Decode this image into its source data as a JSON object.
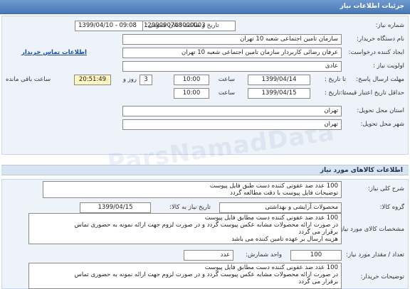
{
  "header": {
    "title": "جزئیات اطلاعات نیاز"
  },
  "need_number": {
    "label": "شماره نیاز:",
    "value": "1299090748000003"
  },
  "announce_date": {
    "label": "تاریخ و ساعت اعلان عمومی:",
    "value": "1399/04/10 - 09:08"
  },
  "buyer_org": {
    "label": "نام دستگاه خریدار:",
    "value": "سازمان تامین اجتماعی شعبه 10 تهران"
  },
  "requester": {
    "label": "ایجاد کننده درخواست:",
    "value": "عرفان رضائی کاربردار سازمان تامین اجتماعی شعبه 10 تهران",
    "contact_link": "اطلاعات تماس خریدار"
  },
  "priority": {
    "label": "اولویت نیاز :",
    "value": "عادی"
  },
  "response_deadline": {
    "label": "مهلت ارسال پاسخ:",
    "to_date_label": "تا تاریخ :",
    "date": "1399/04/14",
    "time_label": "ساعت",
    "time": "10:00",
    "days": "3",
    "days_label": "روز و",
    "remaining": "20:51:49",
    "remaining_label": "ساعت باقی مانده"
  },
  "price_validity": {
    "label": "حداقل تاریخ اعتبار قیمت:",
    "to_date_label": "تا تاریخ :",
    "date": "1399/04/15",
    "time_label": "ساعت",
    "time": "10:00"
  },
  "province": {
    "label": "استان محل تحویل:",
    "value": "تهران"
  },
  "city": {
    "label": "شهر محل تحویل:",
    "value": "تهران"
  },
  "goods_section": {
    "title": "اطلاعات کالاهای مورد نیاز"
  },
  "general_desc": {
    "label": "شرح کلی نیاز:",
    "lines": [
      "100 عدد ضد عفونی کننده دست طبق فایل پیوست",
      "توضیحات فایل پیوست با دقت مطالعه گردد"
    ]
  },
  "goods_group": {
    "label": "گروه کالا:",
    "value": "محصولات آرایشی و بهداشتی",
    "need_date_label": "تاریخ نیاز به کالا:",
    "need_date": "1399/04/15"
  },
  "goods_spec": {
    "label": "مشخصات کالای مورد نیاز:",
    "lines": [
      "100 عدد ضد عفونی کننده دست مطابق فایل پیوست",
      "در صورت ارائه محصولات مشابه عکس پیوست گردد و در صورت لزوم جهت ارائه نمونه به حضوری تماس",
      "برقرار می گردد",
      "هزینه ارسال بر عهده تامین کننده می باشد"
    ]
  },
  "quantity": {
    "label": "تعداد / مقدار مورد نیاز:",
    "value": "100",
    "unit_label": "واحد شمارش:",
    "unit": "عدد"
  },
  "buyer_notes": {
    "label": "توضیحات خریدار:",
    "lines": [
      "100 عدد ضد عفونی کننده دست مطابق فایل پیوست",
      "در صورت ارائه محصولات مشابه عکس پیوست گردد و در صورت لزوم جهت ارائه نمونه به حضوری تماس",
      "برقرار می گردد"
    ]
  }
}
